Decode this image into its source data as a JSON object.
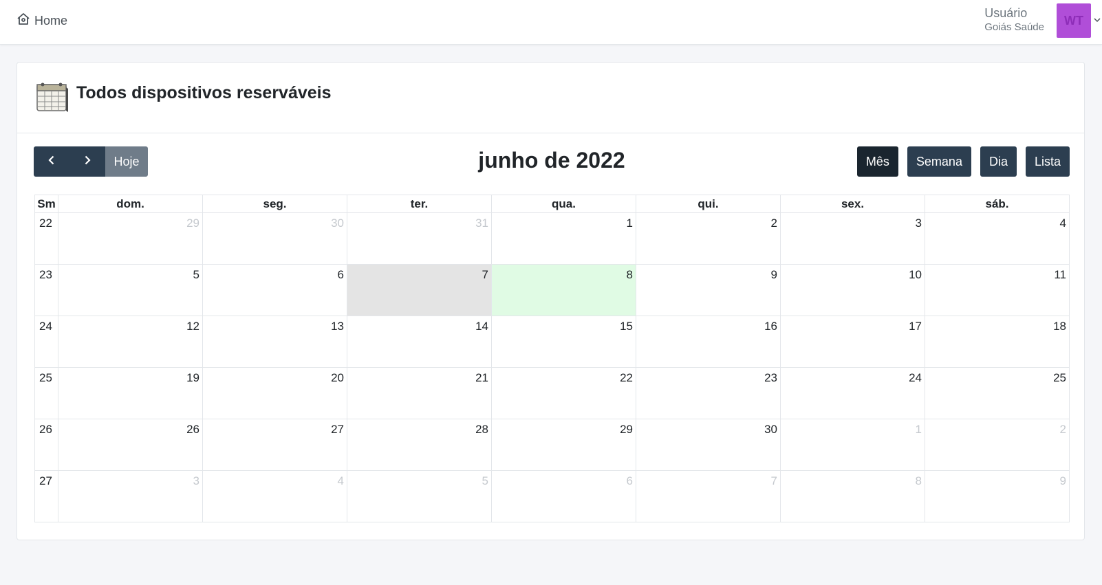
{
  "topbar": {
    "home_label": "Home",
    "user_name": "Usuário",
    "user_org": "Goiás Saúde",
    "avatar_initials": "WT",
    "avatar_color": "#b04ed8"
  },
  "card": {
    "title": "Todos dispositivos reserváveis"
  },
  "toolbar": {
    "today_label": "Hoje",
    "title": "junho de 2022",
    "views": [
      "Mês",
      "Semana",
      "Dia",
      "Lista"
    ],
    "active_view": "Mês"
  },
  "calendar": {
    "week_header": "Sm",
    "day_headers": [
      "dom.",
      "seg.",
      "ter.",
      "qua.",
      "qui.",
      "sex.",
      "sáb."
    ],
    "weeks": [
      {
        "number": "22",
        "days": [
          {
            "d": "29",
            "other": true
          },
          {
            "d": "30",
            "other": true
          },
          {
            "d": "31",
            "other": true
          },
          {
            "d": "1"
          },
          {
            "d": "2"
          },
          {
            "d": "3"
          },
          {
            "d": "4"
          }
        ]
      },
      {
        "number": "23",
        "days": [
          {
            "d": "5"
          },
          {
            "d": "6"
          },
          {
            "d": "7",
            "past_highlight": true
          },
          {
            "d": "8",
            "today": true
          },
          {
            "d": "9"
          },
          {
            "d": "10"
          },
          {
            "d": "11"
          }
        ]
      },
      {
        "number": "24",
        "days": [
          {
            "d": "12"
          },
          {
            "d": "13"
          },
          {
            "d": "14"
          },
          {
            "d": "15"
          },
          {
            "d": "16"
          },
          {
            "d": "17"
          },
          {
            "d": "18"
          }
        ]
      },
      {
        "number": "25",
        "days": [
          {
            "d": "19"
          },
          {
            "d": "20"
          },
          {
            "d": "21"
          },
          {
            "d": "22"
          },
          {
            "d": "23"
          },
          {
            "d": "24"
          },
          {
            "d": "25"
          }
        ]
      },
      {
        "number": "26",
        "days": [
          {
            "d": "26"
          },
          {
            "d": "27"
          },
          {
            "d": "28"
          },
          {
            "d": "29"
          },
          {
            "d": "30"
          },
          {
            "d": "1",
            "other": true
          },
          {
            "d": "2",
            "other": true
          }
        ]
      },
      {
        "number": "27",
        "days": [
          {
            "d": "3",
            "other": true
          },
          {
            "d": "4",
            "other": true
          },
          {
            "d": "5",
            "other": true
          },
          {
            "d": "6",
            "other": true
          },
          {
            "d": "7",
            "other": true
          },
          {
            "d": "8",
            "other": true
          },
          {
            "d": "9",
            "other": true
          }
        ]
      }
    ],
    "today_color": "#e0fbe4",
    "highlight_color": "#e4e4e4"
  }
}
